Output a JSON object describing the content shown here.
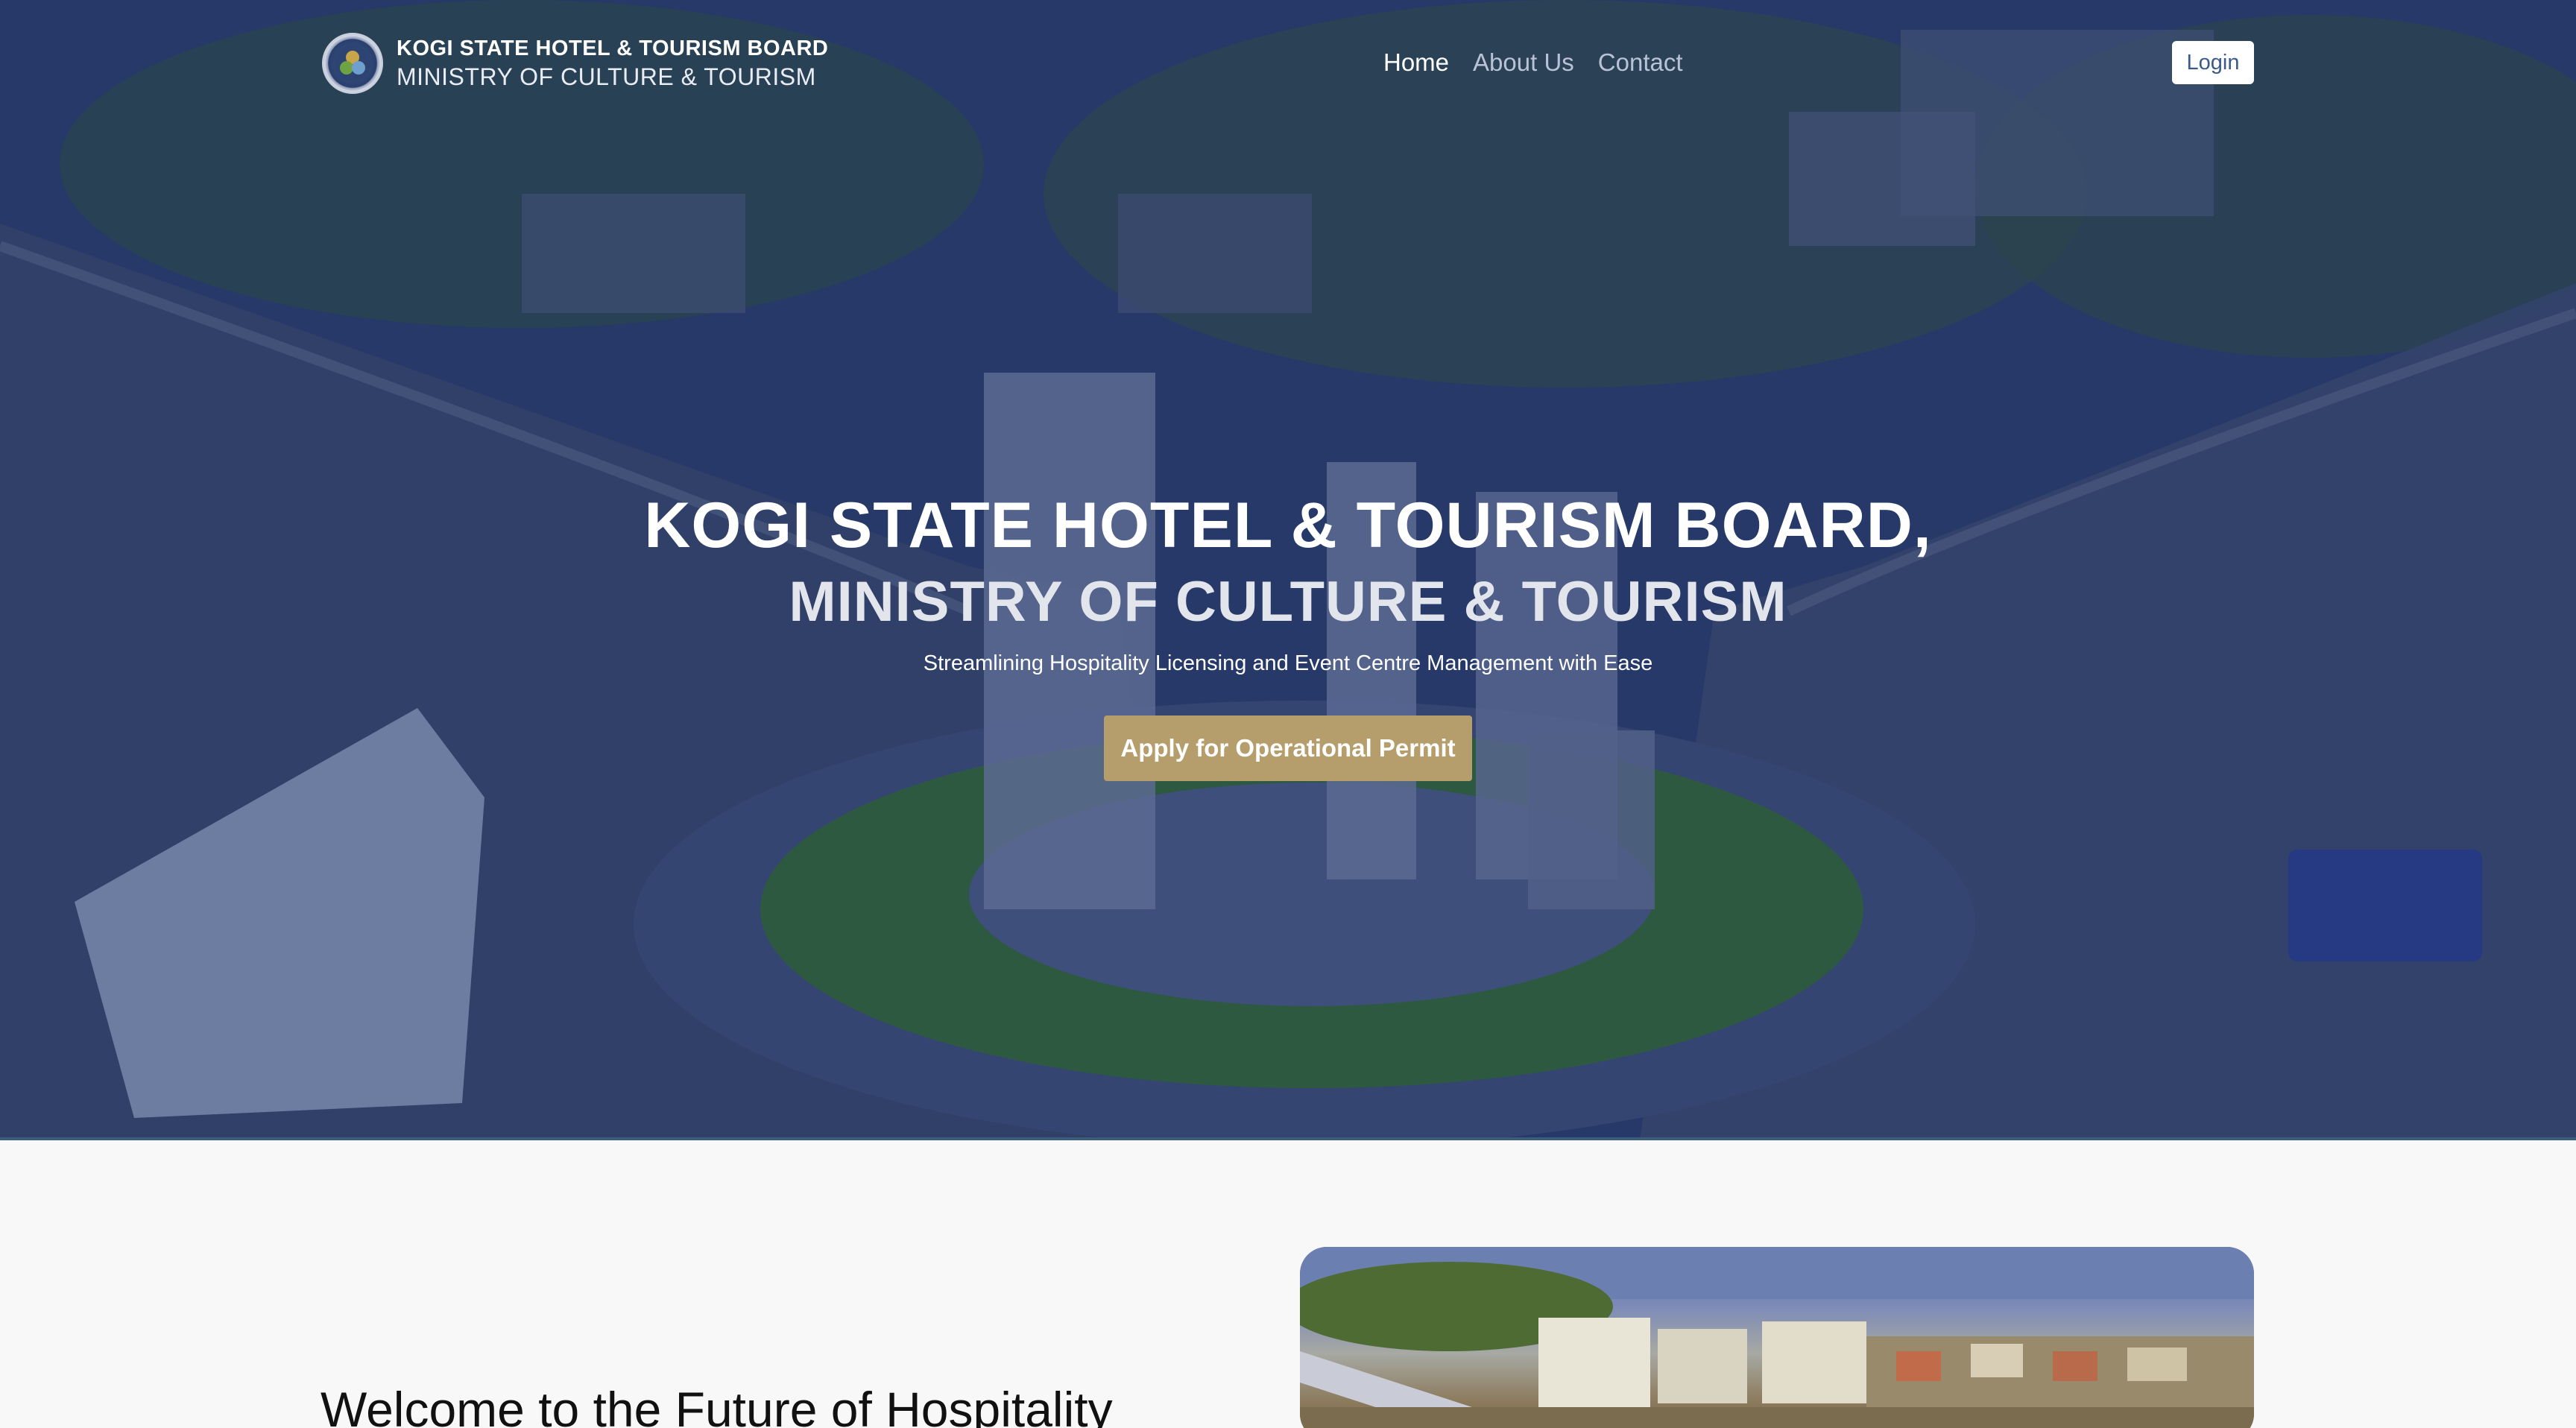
{
  "navbar": {
    "brand_line1": "KOGI STATE HOTEL & TOURISM BOARD",
    "brand_line2": "MINISTRY OF CULTURE & TOURISM",
    "links": [
      {
        "label": "Home",
        "active": true
      },
      {
        "label": "About Us",
        "active": false
      },
      {
        "label": "Contact",
        "active": false
      }
    ],
    "login_label": "Login"
  },
  "hero": {
    "title": "KOGI STATE HOTEL & TOURISM BOARD,",
    "subtitle": "MINISTRY OF CULTURE & TOURISM",
    "tagline": "Streamlining Hospitality Licensing and Event Centre Management with Ease",
    "cta_label": "Apply for Operational Permit"
  },
  "welcome": {
    "heading": "Welcome to the Future of Hospitality"
  },
  "colors": {
    "hero_overlay": "#16285f",
    "cta": "#b59e6b",
    "login_text": "#3a5a8a",
    "page_bg": "#f8f8f8"
  }
}
